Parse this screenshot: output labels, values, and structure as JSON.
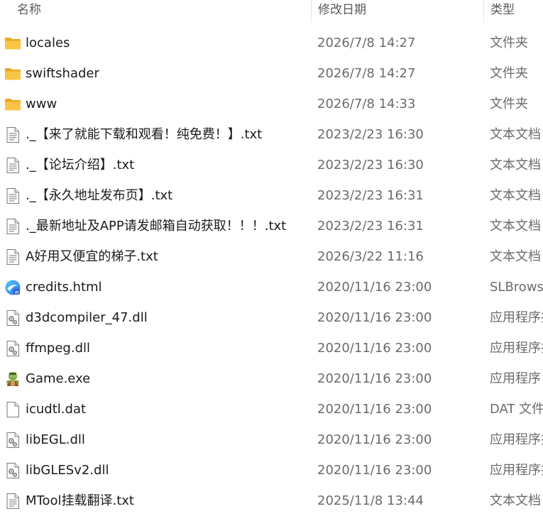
{
  "columns": {
    "name": "名称",
    "date": "修改日期",
    "type": "类型"
  },
  "files": [
    {
      "name": "locales",
      "date": "2026/7/8 14:27",
      "type": "文件夹",
      "icon": "folder-icon"
    },
    {
      "name": "swiftshader",
      "date": "2026/7/8 14:27",
      "type": "文件夹",
      "icon": "folder-icon"
    },
    {
      "name": "www",
      "date": "2026/7/8 14:33",
      "type": "文件夹",
      "icon": "folder-icon"
    },
    {
      "name": "._【来了就能下载和观看！纯免费！】.txt",
      "date": "2023/2/23 16:30",
      "type": "文本文档",
      "icon": "text-file-icon"
    },
    {
      "name": "._【论坛介绍】.txt",
      "date": "2023/2/23 16:30",
      "type": "文本文档",
      "icon": "text-file-icon"
    },
    {
      "name": "._【永久地址发布页】.txt",
      "date": "2023/2/23 16:31",
      "type": "文本文档",
      "icon": "text-file-icon"
    },
    {
      "name": "._最新地址及APP请发邮箱自动获取！！！.txt",
      "date": "2023/2/23 16:31",
      "type": "文本文档",
      "icon": "text-file-icon"
    },
    {
      "name": "A好用又便宜的梯子.txt",
      "date": "2026/3/22 11:16",
      "type": "文本文档",
      "icon": "text-file-icon"
    },
    {
      "name": "credits.html",
      "date": "2020/11/16 23:00",
      "type": "SLBrowser",
      "icon": "browser-html-icon"
    },
    {
      "name": "d3dcompiler_47.dll",
      "date": "2020/11/16 23:00",
      "type": "应用程序扩展",
      "icon": "dll-file-icon"
    },
    {
      "name": "ffmpeg.dll",
      "date": "2020/11/16 23:00",
      "type": "应用程序扩展",
      "icon": "dll-file-icon"
    },
    {
      "name": "Game.exe",
      "date": "2020/11/16 23:00",
      "type": "应用程序",
      "icon": "game-exe-icon"
    },
    {
      "name": "icudtl.dat",
      "date": "2020/11/16 23:00",
      "type": "DAT 文件",
      "icon": "blank-file-icon"
    },
    {
      "name": "libEGL.dll",
      "date": "2020/11/16 23:00",
      "type": "应用程序扩展",
      "icon": "dll-file-icon"
    },
    {
      "name": "libGLESv2.dll",
      "date": "2020/11/16 23:00",
      "type": "应用程序扩展",
      "icon": "dll-file-icon"
    },
    {
      "name": "MTool挂载翻译.txt",
      "date": "2025/11/8 13:44",
      "type": "文本文档",
      "icon": "text-file-icon"
    }
  ],
  "colors": {
    "folder": "#f8c545",
    "folder_dark": "#e8a820",
    "browser_blue": "#1a73e8"
  }
}
